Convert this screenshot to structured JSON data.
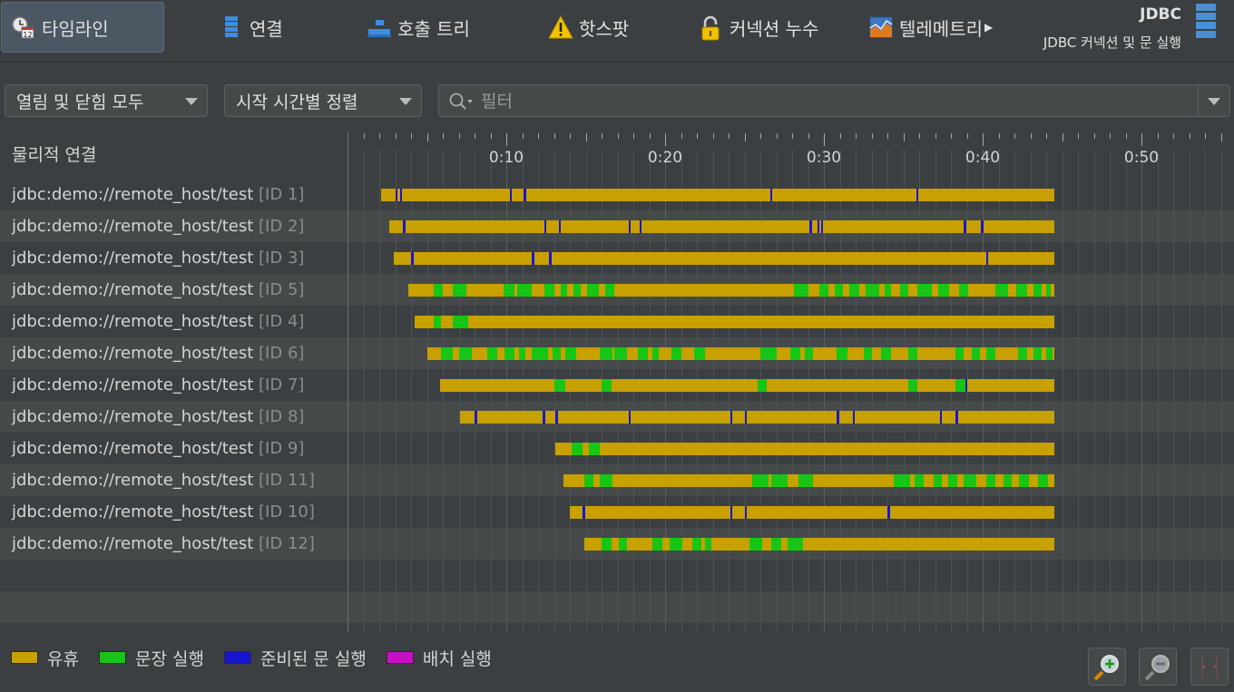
{
  "tabs": [
    {
      "label": "타임라인",
      "icon": "clock-calendar-icon",
      "active": true
    },
    {
      "label": "연결",
      "icon": "database-stack-icon",
      "active": false
    },
    {
      "label": "호출 트리",
      "icon": "call-tree-icon",
      "active": false
    },
    {
      "label": "핫스팟",
      "icon": "warning-triangle-icon",
      "active": false
    },
    {
      "label": "커넥션 누수",
      "icon": "padlock-icon",
      "active": false
    },
    {
      "label": "텔레메트리",
      "icon": "telemetry-chart-icon",
      "active": false
    }
  ],
  "header": {
    "title": "JDBC",
    "subtitle": "JDBC 커넥션 및 문 실행"
  },
  "toolbar": {
    "scope_select": "열림 및 닫힘 모두",
    "sort_select": "시작 시간별 정렬",
    "filter_placeholder": "필터",
    "filter_value": ""
  },
  "rows_header": "물리적 연결",
  "axis": {
    "unit": "seconds",
    "range": [
      0,
      55
    ],
    "labels": [
      "0:10",
      "0:20",
      "0:30",
      "0:40",
      "0:50"
    ],
    "label_values": [
      10,
      20,
      30,
      40,
      50
    ]
  },
  "colors": {
    "idle": "#c8a000",
    "statement": "#16c516",
    "prepared": "#1616d0",
    "batch": "#c80fc8"
  },
  "rows": [
    {
      "name": "jdbc:demo://remote_host/test",
      "id": "[ID 1]",
      "start": 2.1,
      "end": 44.5,
      "events": [
        {
          "t": 3.0,
          "w": 0.15,
          "k": "prepared"
        },
        {
          "t": 3.3,
          "w": 0.15,
          "k": "prepared"
        },
        {
          "t": 10.2,
          "w": 0.15,
          "k": "prepared"
        },
        {
          "t": 11.1,
          "w": 0.15,
          "k": "prepared"
        },
        {
          "t": 26.6,
          "w": 0.1,
          "k": "prepared"
        },
        {
          "t": 35.8,
          "w": 0.15,
          "k": "prepared"
        }
      ]
    },
    {
      "name": "jdbc:demo://remote_host/test",
      "id": "[ID 2]",
      "start": 2.6,
      "end": 44.5,
      "events": [
        {
          "t": 3.5,
          "w": 0.15,
          "k": "prepared"
        },
        {
          "t": 12.4,
          "w": 0.1,
          "k": "prepared"
        },
        {
          "t": 13.3,
          "w": 0.1,
          "k": "prepared"
        },
        {
          "t": 17.7,
          "w": 0.15,
          "k": "prepared"
        },
        {
          "t": 18.4,
          "w": 0.1,
          "k": "prepared"
        },
        {
          "t": 29.1,
          "w": 0.15,
          "k": "prepared"
        },
        {
          "t": 29.6,
          "w": 0.1,
          "k": "prepared"
        },
        {
          "t": 29.8,
          "w": 0.1,
          "k": "prepared"
        },
        {
          "t": 38.8,
          "w": 0.15,
          "k": "prepared"
        },
        {
          "t": 39.9,
          "w": 0.15,
          "k": "prepared"
        }
      ]
    },
    {
      "name": "jdbc:demo://remote_host/test",
      "id": "[ID 3]",
      "start": 2.9,
      "end": 44.5,
      "events": [
        {
          "t": 4.0,
          "w": 0.15,
          "k": "prepared"
        },
        {
          "t": 11.6,
          "w": 0.15,
          "k": "prepared"
        },
        {
          "t": 12.7,
          "w": 0.15,
          "k": "prepared"
        },
        {
          "t": 40.2,
          "w": 0.15,
          "k": "prepared"
        }
      ]
    },
    {
      "name": "jdbc:demo://remote_host/test",
      "id": "[ID 5]",
      "start": 3.8,
      "end": 44.5,
      "events": [
        {
          "t": 5.4,
          "w": 0.6,
          "k": "statement"
        },
        {
          "t": 6.6,
          "w": 0.9,
          "k": "statement"
        },
        {
          "t": 9.8,
          "w": 0.7,
          "k": "statement"
        },
        {
          "t": 10.7,
          "w": 0.9,
          "k": "statement"
        },
        {
          "t": 12.4,
          "w": 0.6,
          "k": "statement"
        },
        {
          "t": 13.4,
          "w": 0.4,
          "k": "statement"
        },
        {
          "t": 14.2,
          "w": 0.5,
          "k": "statement"
        },
        {
          "t": 15.1,
          "w": 0.7,
          "k": "statement"
        },
        {
          "t": 16.2,
          "w": 0.6,
          "k": "statement"
        },
        {
          "t": 28.1,
          "w": 0.9,
          "k": "statement"
        },
        {
          "t": 29.7,
          "w": 0.6,
          "k": "statement"
        },
        {
          "t": 30.7,
          "w": 0.5,
          "k": "statement"
        },
        {
          "t": 31.6,
          "w": 0.6,
          "k": "statement"
        },
        {
          "t": 32.6,
          "w": 0.9,
          "k": "statement"
        },
        {
          "t": 33.8,
          "w": 0.4,
          "k": "statement"
        },
        {
          "t": 34.8,
          "w": 0.5,
          "k": "statement"
        },
        {
          "t": 35.9,
          "w": 0.9,
          "k": "statement"
        },
        {
          "t": 37.2,
          "w": 0.7,
          "k": "statement"
        },
        {
          "t": 38.5,
          "w": 0.6,
          "k": "statement"
        },
        {
          "t": 40.8,
          "w": 0.8,
          "k": "statement"
        },
        {
          "t": 42.1,
          "w": 0.7,
          "k": "statement"
        },
        {
          "t": 43.2,
          "w": 0.5,
          "k": "statement"
        },
        {
          "t": 44.0,
          "w": 0.3,
          "k": "statement"
        }
      ]
    },
    {
      "name": "jdbc:demo://remote_host/test",
      "id": "[ID 4]",
      "start": 4.2,
      "end": 44.5,
      "events": [
        {
          "t": 5.4,
          "w": 0.5,
          "k": "statement"
        },
        {
          "t": 6.6,
          "w": 1.0,
          "k": "statement"
        }
      ]
    },
    {
      "name": "jdbc:demo://remote_host/test",
      "id": "[ID 6]",
      "start": 5.0,
      "end": 44.5,
      "events": [
        {
          "t": 5.9,
          "w": 0.7,
          "k": "statement"
        },
        {
          "t": 7.0,
          "w": 0.8,
          "k": "statement"
        },
        {
          "t": 8.8,
          "w": 0.6,
          "k": "statement"
        },
        {
          "t": 9.9,
          "w": 0.6,
          "k": "statement"
        },
        {
          "t": 10.8,
          "w": 0.4,
          "k": "statement"
        },
        {
          "t": 11.6,
          "w": 1.0,
          "k": "statement"
        },
        {
          "t": 12.9,
          "w": 0.5,
          "k": "statement"
        },
        {
          "t": 13.7,
          "w": 0.7,
          "k": "statement"
        },
        {
          "t": 15.9,
          "w": 0.8,
          "k": "statement"
        },
        {
          "t": 16.8,
          "w": 0.8,
          "k": "statement"
        },
        {
          "t": 18.3,
          "w": 0.6,
          "k": "statement"
        },
        {
          "t": 19.2,
          "w": 0.4,
          "k": "statement"
        },
        {
          "t": 20.4,
          "w": 0.6,
          "k": "statement"
        },
        {
          "t": 21.8,
          "w": 0.7,
          "k": "statement"
        },
        {
          "t": 26.0,
          "w": 1.0,
          "k": "statement"
        },
        {
          "t": 27.9,
          "w": 0.6,
          "k": "statement"
        },
        {
          "t": 28.8,
          "w": 0.5,
          "k": "statement"
        },
        {
          "t": 30.8,
          "w": 0.7,
          "k": "statement"
        },
        {
          "t": 32.5,
          "w": 0.5,
          "k": "statement"
        },
        {
          "t": 33.6,
          "w": 0.6,
          "k": "statement"
        },
        {
          "t": 35.3,
          "w": 0.6,
          "k": "statement"
        },
        {
          "t": 38.3,
          "w": 0.5,
          "k": "statement"
        },
        {
          "t": 39.3,
          "w": 0.5,
          "k": "statement"
        },
        {
          "t": 40.2,
          "w": 0.6,
          "k": "statement"
        },
        {
          "t": 42.2,
          "w": 0.6,
          "k": "statement"
        },
        {
          "t": 43.2,
          "w": 0.5,
          "k": "statement"
        },
        {
          "t": 44.0,
          "w": 0.4,
          "k": "statement"
        }
      ]
    },
    {
      "name": "jdbc:demo://remote_host/test",
      "id": "[ID 7]",
      "start": 5.8,
      "end": 44.5,
      "events": [
        {
          "t": 13.0,
          "w": 0.7,
          "k": "statement"
        },
        {
          "t": 16.0,
          "w": 0.6,
          "k": "statement"
        },
        {
          "t": 25.8,
          "w": 0.6,
          "k": "statement"
        },
        {
          "t": 35.3,
          "w": 0.6,
          "k": "statement"
        },
        {
          "t": 38.3,
          "w": 0.6,
          "k": "statement"
        },
        {
          "t": 38.9,
          "w": 0.1,
          "k": "prepared"
        }
      ]
    },
    {
      "name": "jdbc:demo://remote_host/test",
      "id": "[ID 8]",
      "start": 7.1,
      "end": 44.5,
      "events": [
        {
          "t": 8.0,
          "w": 0.15,
          "k": "prepared"
        },
        {
          "t": 12.3,
          "w": 0.15,
          "k": "prepared"
        },
        {
          "t": 13.1,
          "w": 0.15,
          "k": "prepared"
        },
        {
          "t": 17.7,
          "w": 0.1,
          "k": "prepared"
        },
        {
          "t": 24.1,
          "w": 0.15,
          "k": "prepared"
        },
        {
          "t": 25.0,
          "w": 0.15,
          "k": "prepared"
        },
        {
          "t": 30.8,
          "w": 0.15,
          "k": "prepared"
        },
        {
          "t": 31.8,
          "w": 0.15,
          "k": "prepared"
        },
        {
          "t": 37.3,
          "w": 0.15,
          "k": "prepared"
        },
        {
          "t": 38.3,
          "w": 0.15,
          "k": "prepared"
        }
      ]
    },
    {
      "name": "jdbc:demo://remote_host/test",
      "id": "[ID 9]",
      "start": 13.1,
      "end": 44.5,
      "events": [
        {
          "t": 14.1,
          "w": 0.7,
          "k": "statement"
        },
        {
          "t": 15.2,
          "w": 0.7,
          "k": "statement"
        }
      ]
    },
    {
      "name": "jdbc:demo://remote_host/test",
      "id": "[ID 11]",
      "start": 13.6,
      "end": 44.5,
      "events": [
        {
          "t": 14.9,
          "w": 0.6,
          "k": "statement"
        },
        {
          "t": 15.9,
          "w": 0.8,
          "k": "statement"
        },
        {
          "t": 25.5,
          "w": 1.0,
          "k": "statement"
        },
        {
          "t": 26.7,
          "w": 1.0,
          "k": "statement"
        },
        {
          "t": 28.4,
          "w": 0.9,
          "k": "statement"
        },
        {
          "t": 34.4,
          "w": 1.0,
          "k": "statement"
        },
        {
          "t": 35.7,
          "w": 0.6,
          "k": "statement"
        },
        {
          "t": 36.9,
          "w": 0.5,
          "k": "statement"
        },
        {
          "t": 37.8,
          "w": 0.6,
          "k": "statement"
        },
        {
          "t": 38.8,
          "w": 0.8,
          "k": "statement"
        },
        {
          "t": 40.2,
          "w": 0.6,
          "k": "statement"
        },
        {
          "t": 41.3,
          "w": 0.5,
          "k": "statement"
        },
        {
          "t": 42.3,
          "w": 0.6,
          "k": "statement"
        },
        {
          "t": 43.5,
          "w": 0.6,
          "k": "statement"
        }
      ]
    },
    {
      "name": "jdbc:demo://remote_host/test",
      "id": "[ID 10]",
      "start": 14.0,
      "end": 44.5,
      "events": [
        {
          "t": 14.8,
          "w": 0.15,
          "k": "prepared"
        },
        {
          "t": 24.1,
          "w": 0.15,
          "k": "prepared"
        },
        {
          "t": 25.0,
          "w": 0.15,
          "k": "prepared"
        },
        {
          "t": 34.0,
          "w": 0.15,
          "k": "prepared"
        }
      ]
    },
    {
      "name": "jdbc:demo://remote_host/test",
      "id": "[ID 12]",
      "start": 14.9,
      "end": 44.5,
      "events": [
        {
          "t": 16.0,
          "w": 0.6,
          "k": "statement"
        },
        {
          "t": 17.1,
          "w": 0.5,
          "k": "statement"
        },
        {
          "t": 19.2,
          "w": 0.6,
          "k": "statement"
        },
        {
          "t": 20.3,
          "w": 0.8,
          "k": "statement"
        },
        {
          "t": 21.7,
          "w": 0.6,
          "k": "statement"
        },
        {
          "t": 22.5,
          "w": 0.4,
          "k": "statement"
        },
        {
          "t": 25.3,
          "w": 0.8,
          "k": "statement"
        },
        {
          "t": 26.7,
          "w": 0.6,
          "k": "statement"
        },
        {
          "t": 27.7,
          "w": 1.0,
          "k": "statement"
        }
      ]
    }
  ],
  "legend": [
    {
      "label": "유휴",
      "key": "idle"
    },
    {
      "label": "문장 실행",
      "key": "statement"
    },
    {
      "label": "준비된 문 실행",
      "key": "prepared"
    },
    {
      "label": "배치 실행",
      "key": "batch"
    }
  ],
  "zoom_buttons": [
    {
      "name": "zoom-in-button",
      "icon": "magnifier-plus-icon"
    },
    {
      "name": "zoom-out-button",
      "icon": "magnifier-minus-icon"
    },
    {
      "name": "fit-width-button",
      "icon": "fit-arrows-icon"
    }
  ]
}
